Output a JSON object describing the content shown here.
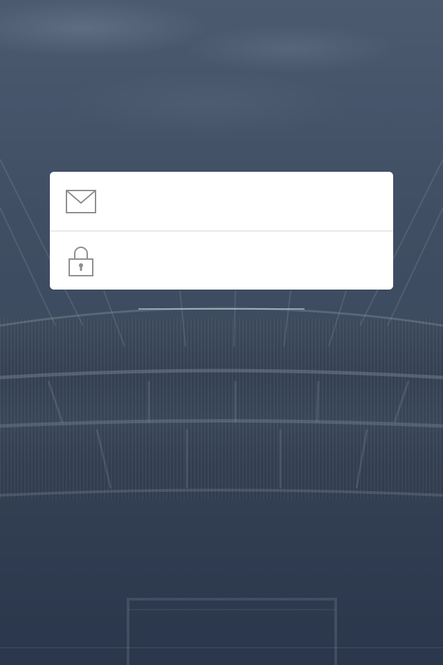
{
  "login": {
    "email": {
      "icon": "envelope-icon",
      "value": "",
      "placeholder": ""
    },
    "password": {
      "icon": "lock-icon",
      "value": "",
      "placeholder": ""
    }
  },
  "colors": {
    "card_background": "#ffffff",
    "icon_stroke": "#8e8e8e",
    "separator": "#d8d8d8",
    "overlay": "#3e4c60"
  }
}
